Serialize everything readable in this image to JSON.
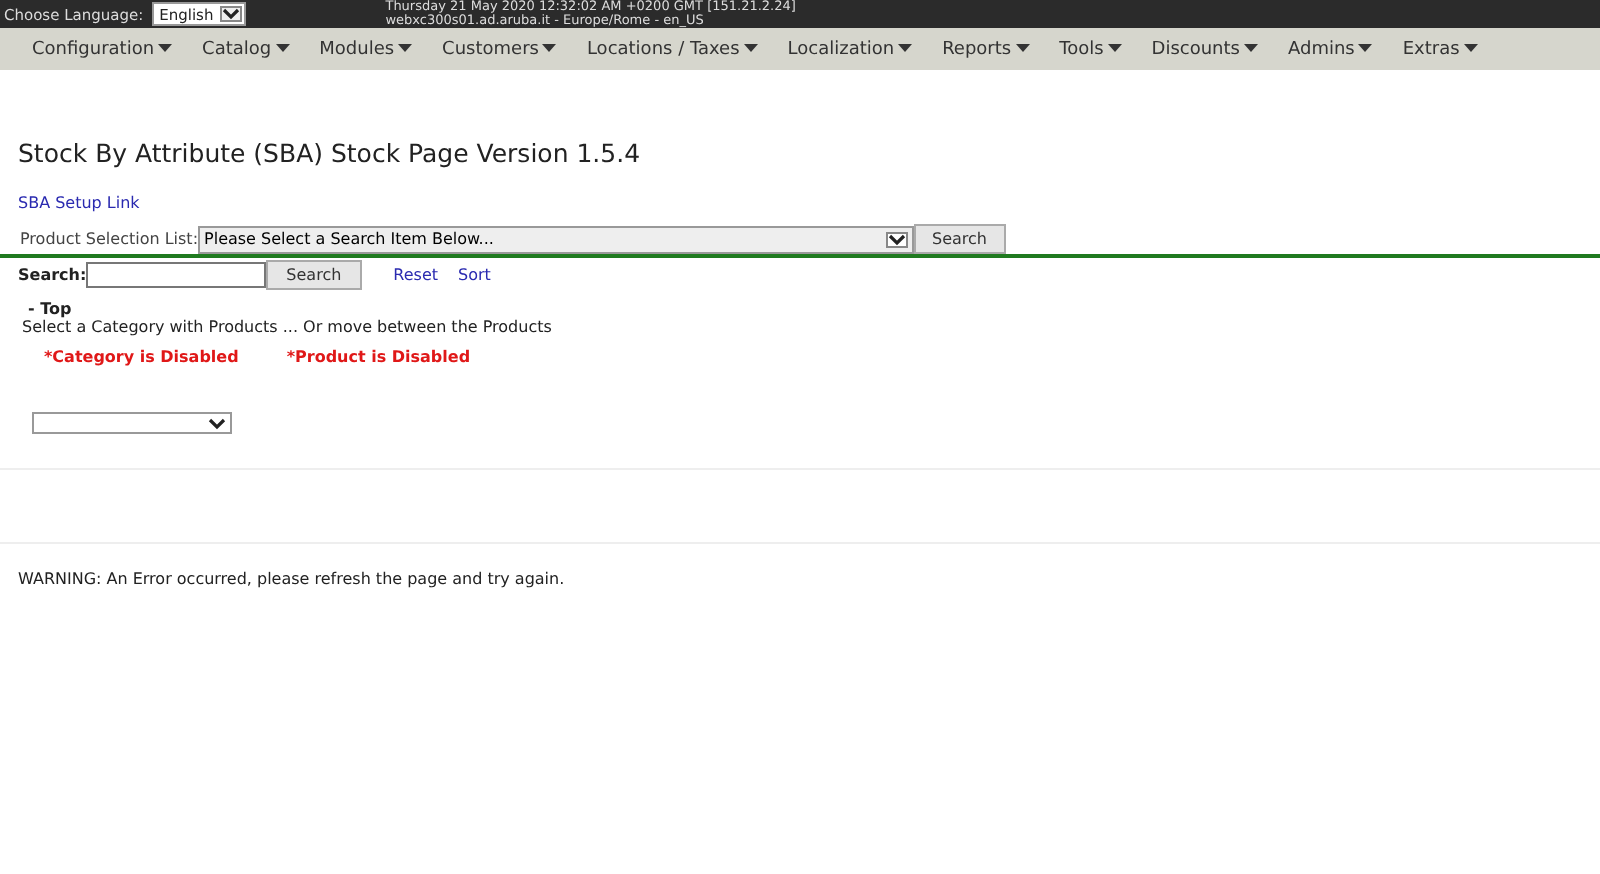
{
  "top_bar": {
    "language_label": "Choose Language:",
    "language": "English",
    "datetime": "Thursday 21 May 2020 12:32:02 AM +0200 GMT [151.21.2.24]",
    "server": "webxc300s01.ad.aruba.it - Europe/Rome - en_US"
  },
  "menu": [
    "Configuration",
    "Catalog",
    "Modules",
    "Customers",
    "Locations / Taxes",
    "Localization",
    "Reports",
    "Tools",
    "Discounts",
    "Admins",
    "Extras"
  ],
  "page_title": "Stock By Attribute (SBA) Stock Page Version 1.5.4",
  "setup_link": "SBA Setup Link",
  "product_selection": {
    "label": "Product Selection List:",
    "value": "Please Select a Search Item Below...",
    "button": "Search"
  },
  "search": {
    "label": "Search:",
    "button": "Search",
    "links": [
      "Reset",
      "Sort"
    ]
  },
  "category": {
    "top": "- Top",
    "hint": "Select a Category with Products ... Or move between the Products",
    "notices": [
      "*Category is Disabled",
      "*Product is Disabled"
    ]
  },
  "warning": "WARNING: An Error occurred, please refresh the page and try again."
}
